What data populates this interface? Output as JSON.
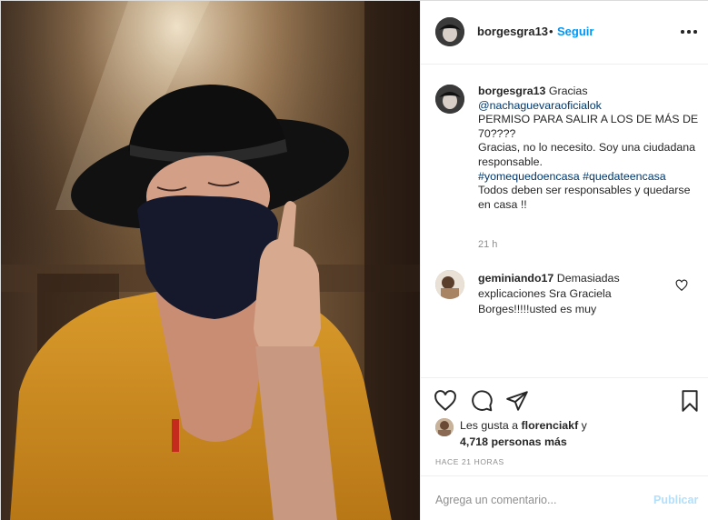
{
  "post": {
    "author": "borgesgra13",
    "follow_label": "Seguir",
    "separator": "•",
    "more_icon": "more-options-icon",
    "caption": {
      "username": "borgesgra13",
      "intro": "Gracias",
      "mention": "@nachaguevaraoficialok",
      "line_question": "PERMISO PARA SALIR A LOS DE MÁS DE 70????",
      "line_answer": "Gracias, no lo necesito. Soy una ciudadana responsable.",
      "hashtag_1": "#yomequedoencasa",
      "hashtag_2": "#quedateencasa",
      "line_closing": "Todos deben ser responsables y quedarse en casa !!",
      "time": "21 h"
    },
    "comments": [
      {
        "username": "geminiando17",
        "text": "Demasiadas explicaciones Sra Graciela Borges!!!!!usted es muy"
      }
    ],
    "likes": {
      "prefix": "Les gusta a",
      "user": "florenciakf",
      "connector": "y",
      "count": "4,718 personas más"
    },
    "posted_ago": "HACE 21 HORAS",
    "add_comment_placeholder": "Agrega un comentario...",
    "publish_label": "Publicar",
    "icons": {
      "like": "heart-icon",
      "comment": "comment-icon",
      "share": "share-icon",
      "save": "bookmark-icon"
    },
    "colors": {
      "link": "#00376b",
      "follow": "#0095f6",
      "publish_disabled": "#b2dffc",
      "muted": "#8e8e8e"
    }
  }
}
